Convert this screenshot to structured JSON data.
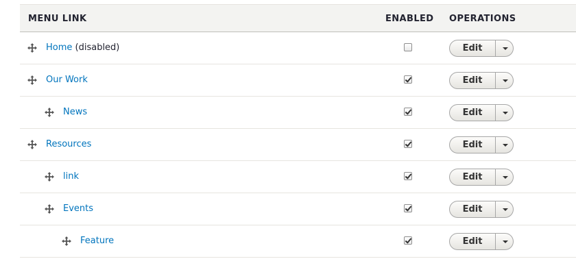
{
  "table": {
    "headers": {
      "menu_link": "MENU LINK",
      "enabled": "ENABLED",
      "operations": "OPERATIONS"
    },
    "rows": [
      {
        "label": "Home",
        "suffix": " (disabled)",
        "depth": 0,
        "enabled": false,
        "edit_label": "Edit"
      },
      {
        "label": "Our Work",
        "suffix": "",
        "depth": 0,
        "enabled": true,
        "edit_label": "Edit"
      },
      {
        "label": "News",
        "suffix": "",
        "depth": 1,
        "enabled": true,
        "edit_label": "Edit"
      },
      {
        "label": "Resources",
        "suffix": "",
        "depth": 0,
        "enabled": true,
        "edit_label": "Edit"
      },
      {
        "label": "link",
        "suffix": "",
        "depth": 1,
        "enabled": true,
        "edit_label": "Edit"
      },
      {
        "label": "Events",
        "suffix": "",
        "depth": 1,
        "enabled": true,
        "edit_label": "Edit"
      },
      {
        "label": "Feature",
        "suffix": "",
        "depth": 2,
        "enabled": true,
        "edit_label": "Edit"
      }
    ]
  },
  "colors": {
    "link": "#0074bd",
    "header_bg": "#f3f3f1",
    "row_border": "#e6e4df"
  },
  "icons": {
    "drag_handle": "move-arrows-icon",
    "dropdown_toggle": "chevron-down-icon"
  }
}
